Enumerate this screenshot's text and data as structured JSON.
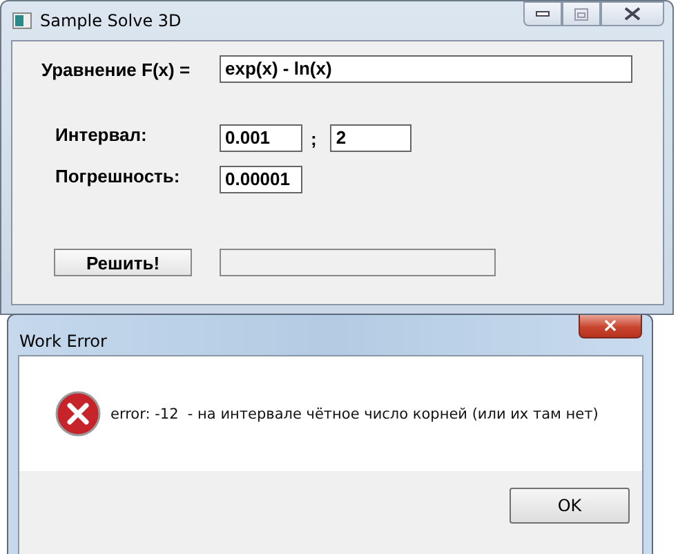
{
  "main_window": {
    "title": "Sample Solve 3D",
    "equation": {
      "label": "Уравнение F(x) =",
      "value": "exp(x) - ln(x)"
    },
    "interval": {
      "label": "Интервал:",
      "from": "0.001",
      "separator": ";",
      "to": "2"
    },
    "tolerance": {
      "label": "Погрешность:",
      "value": "0.00001"
    },
    "solve_button": "Решить!"
  },
  "dialog": {
    "title": "Work Error",
    "close": "×",
    "message": "error: -12  - на интервале чётное число корней (или их там нет)",
    "ok_button": "OK"
  }
}
